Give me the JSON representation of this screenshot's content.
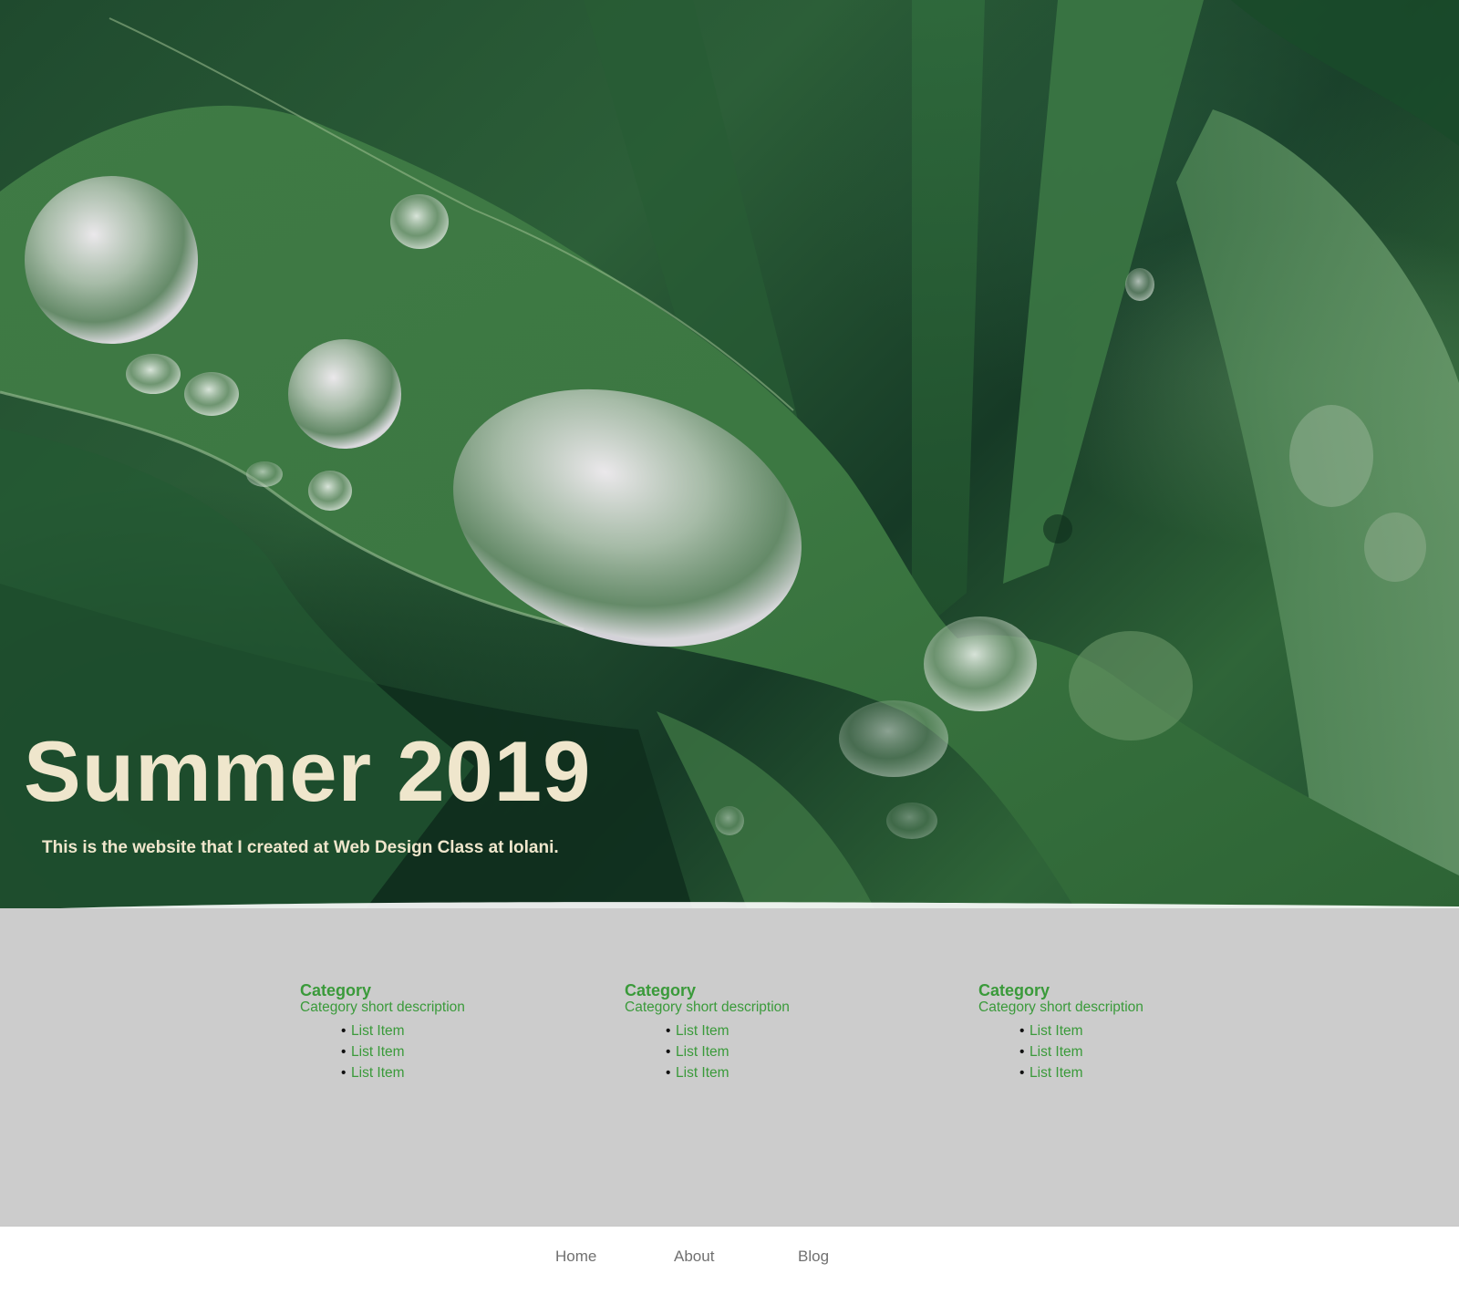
{
  "hero": {
    "title": "Summer 2019",
    "subtitle": "This is the website that I created at Web Design Class at Iolani.",
    "background_image": "green-leaf-water-droplets-photo",
    "title_color": "#efe6cc"
  },
  "categories": [
    {
      "title": "Category",
      "description": "Category short description",
      "items": [
        "List Item",
        "List Item",
        "List Item"
      ]
    },
    {
      "title": "Category",
      "description": "Category short description",
      "items": [
        "List Item",
        "List Item",
        "List Item"
      ]
    },
    {
      "title": "Category",
      "description": "Category short description",
      "items": [
        "List Item",
        "List Item",
        "List Item"
      ]
    }
  ],
  "nav": {
    "items": [
      "Home",
      "About",
      "Blog"
    ]
  },
  "colors": {
    "accent_green": "#3a9a3a",
    "category_band": "#cccccc",
    "nav_text": "#707070"
  }
}
